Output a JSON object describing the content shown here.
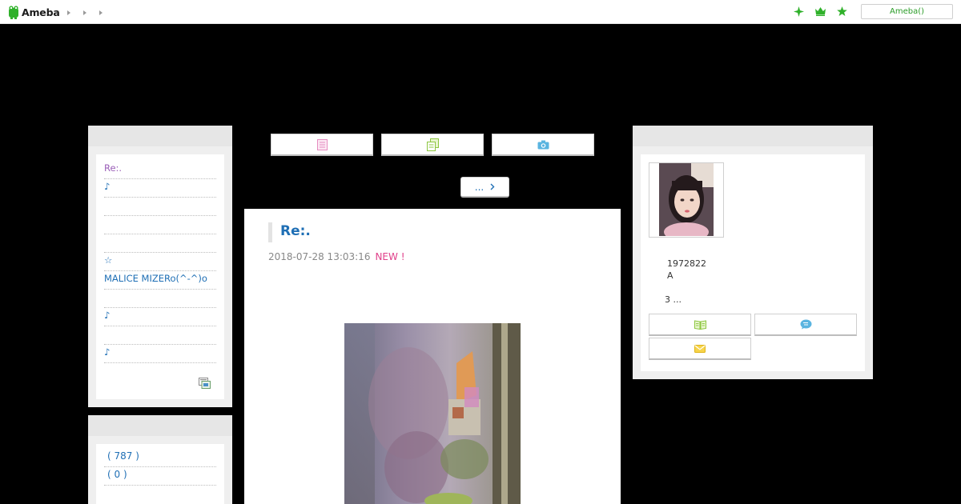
{
  "header": {
    "logo_text": "Ameba",
    "breadcrumb_count": 3,
    "search_label": "Ameba()",
    "icons": [
      "sparkle-icon",
      "crown-icon",
      "star-icon"
    ],
    "accent_color": "#2fb12a"
  },
  "left_sidebar": {
    "recent_entries": [
      "Re:.",
      "♪",
      "",
      "",
      "",
      "☆",
      "MALICE MIZERo(^-^)o",
      "",
      "♪",
      "",
      "♪"
    ],
    "active_entry_index": 0,
    "counts": [
      "( 787 )",
      "( 0 )"
    ]
  },
  "center": {
    "tab_icons": [
      "entry-list-icon",
      "copy-icon",
      "camera-icon"
    ],
    "more_button_label": "...",
    "article": {
      "title": "Re:.",
      "date": "2018-07-28 13:03:16",
      "new_badge": "NEW !"
    }
  },
  "right_sidebar": {
    "profile_number": "1972822",
    "profile_line2": "A",
    "profile_more": "3 ...",
    "buttons": [
      "book-icon",
      "chat-icon",
      "mail-icon"
    ]
  },
  "colors": {
    "link": "#1f6fb5",
    "visited": "#9b5fb8",
    "new_badge": "#e0408a",
    "background": "#000000"
  }
}
